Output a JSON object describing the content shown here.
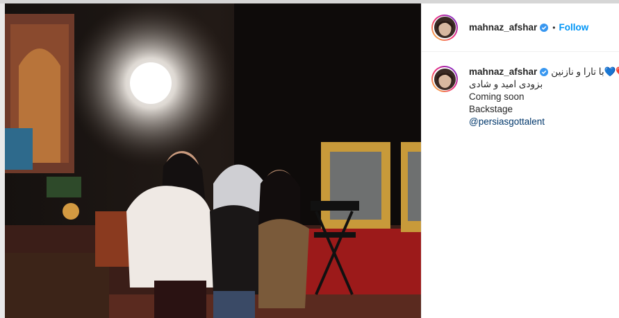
{
  "post": {
    "username": "mahnaz_afshar",
    "verified": true,
    "separator": "•",
    "follow_label": "Follow",
    "caption": {
      "line1": "❤️💙با تارا و نازنین",
      "line2": "بزودی امید و شادی",
      "line3": "Coming soon",
      "line4": "Backstage",
      "mention": "@persiasgottalent"
    }
  },
  "icons": {
    "verified": "verified-badge-icon",
    "avatar": "profile-avatar"
  },
  "colors": {
    "follow": "#0095f6",
    "mention": "#00376b",
    "verified": "#3897f0",
    "text": "#262626"
  }
}
